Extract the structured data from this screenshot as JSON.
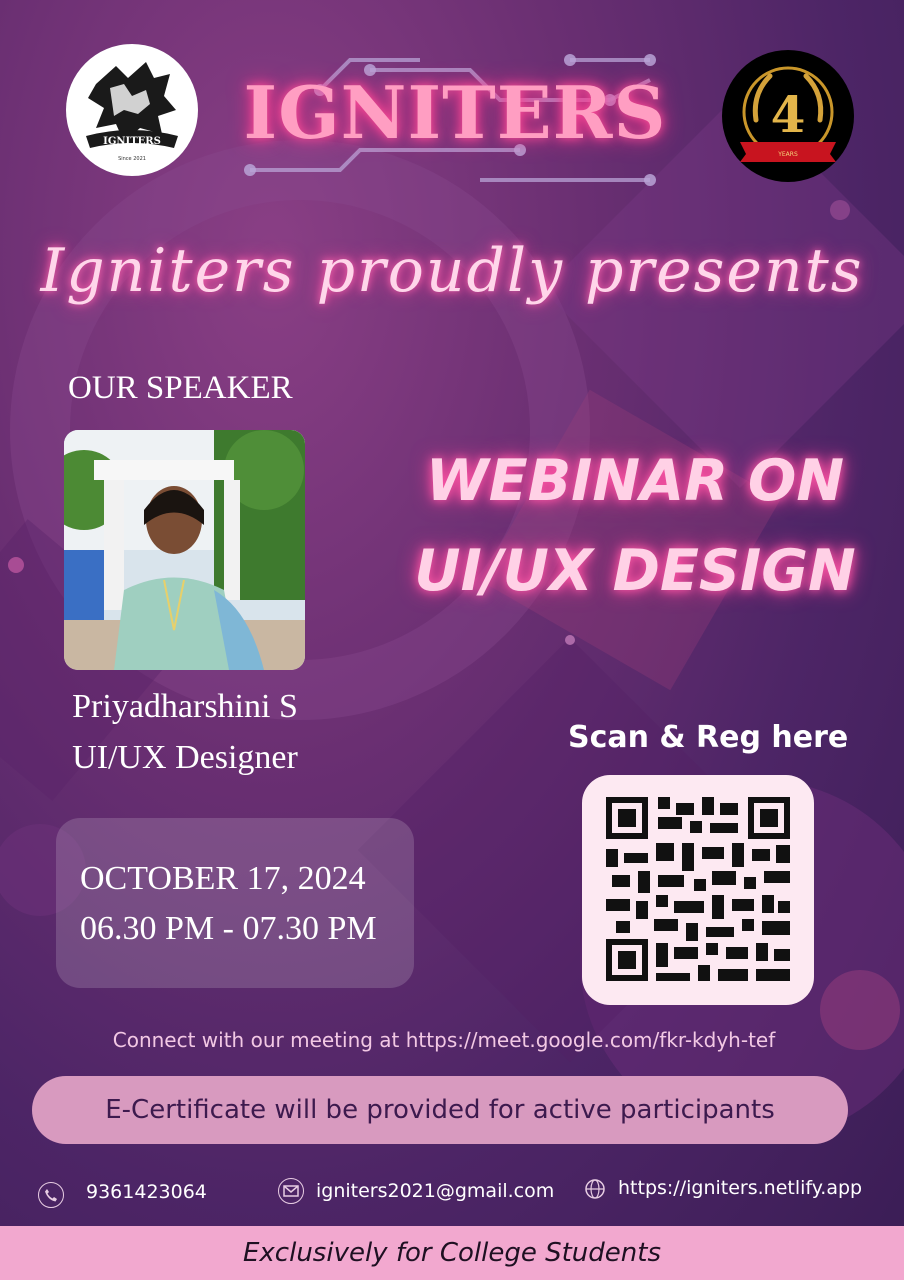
{
  "brand": {
    "name": "IGNITERS",
    "logo_text": "IGNITERS",
    "logo_subtext": "Since 2021",
    "anniversary_number": "4",
    "anniversary_subtext": "YEARS"
  },
  "tagline": "Igniters proudly presents",
  "speaker": {
    "heading": "OUR SPEAKER",
    "name": "Priyadharshini S",
    "role": "UI/UX Designer"
  },
  "event": {
    "title_line1": "WEBINAR ON",
    "title_line2": "UI/UX DESIGN",
    "date": "OCTOBER 17, 2024",
    "time": "06.30 PM - 07.30 PM"
  },
  "registration": {
    "label": "Scan & Reg here"
  },
  "meeting_text": "Connect with our meeting at https://meet.google.com/fkr-kdyh-tef",
  "certificate_text": "E-Certificate will be provided for active participants",
  "contacts": {
    "phone": "9361423064",
    "email": "igniters2021@gmail.com",
    "website": "https://igniters.netlify.app"
  },
  "footer": "Exclusively for College Students",
  "colors": {
    "background": "#5a2a6e",
    "neon_pink": "#ff9ec2",
    "certificate_bar": "#d89abf",
    "footer_bar": "#f2a8cf"
  }
}
